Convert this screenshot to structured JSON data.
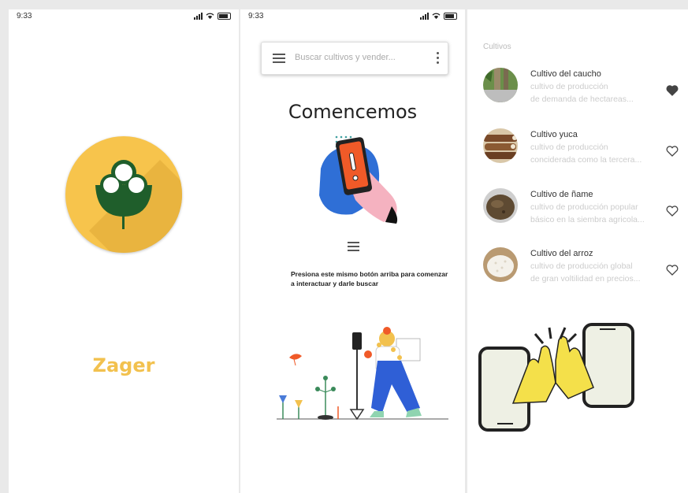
{
  "status_bar": {
    "time": "9:33"
  },
  "splash": {
    "brand": "Zager"
  },
  "search_screen": {
    "search_placeholder": "Buscar cultivos y vender...",
    "title": "Comencemos",
    "instruction": "Presiona este mismo botón arriba para comenzar a interactuar y darle buscar"
  },
  "crops_screen": {
    "section_title": "Cultivos",
    "items": [
      {
        "name": "Cultivo del caucho",
        "line1": "cultivo de producción",
        "line2": "de demanda de hectareas...",
        "favorite": true
      },
      {
        "name": "Cultivo yuca",
        "line1": "cultivo de producción",
        "line2": "conciderada como la tercera...",
        "favorite": false
      },
      {
        "name": "Cultivo de ñame",
        "line1": "cultivo de producción popular",
        "line2": "básico en la siembra agricola...",
        "favorite": false
      },
      {
        "name": "Cultivo del arroz",
        "line1": "cultivo de producción global",
        "line2": "de gran voltilidad en precios...",
        "favorite": false
      }
    ]
  },
  "colors": {
    "brand_yellow": "#f7c44c",
    "leaf_green": "#1f5e2b",
    "accent_blue": "#2f6fd6",
    "accent_orange": "#f05a28"
  },
  "icons": [
    "signal-icon",
    "wifi-icon",
    "battery-icon",
    "menu-icon",
    "more-vert-icon",
    "heart-icon"
  ]
}
